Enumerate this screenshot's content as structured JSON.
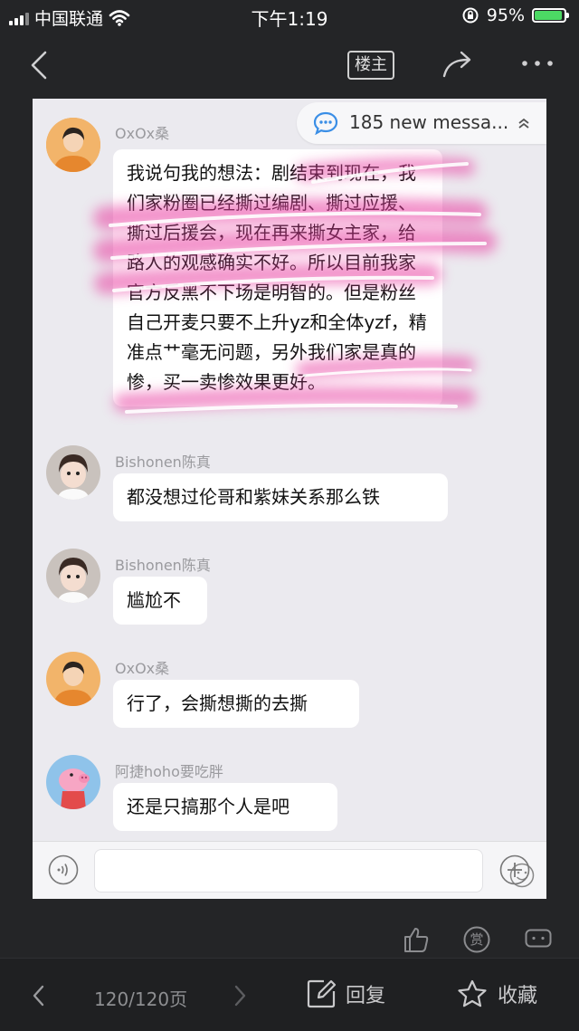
{
  "status_bar": {
    "carrier": "中国联通",
    "time": "下午1:19",
    "battery_percent": "95%",
    "battery_level": 0.95,
    "battery_color": "#4cd964"
  },
  "nav_bar": {
    "back_icon": "chevron-left-icon",
    "louzhu_label": "楼主",
    "share_icon": "share-arrow-icon",
    "more_icon": "more-dots-icon"
  },
  "chat": {
    "new_messages_banner": "185 new messa...",
    "messages": [
      {
        "sender": "OxOx桑",
        "text": "我说句我的想法：剧结束到现在，我们家粉圈已经撕过编剧、撕过应援、撕过后援会，现在再来撕女主家，给路人的观感确实不好。所以目前我家官方反黑不下场是明智的。但是粉丝自己开麦只要不上升yz和全体yzf，精准点艹毫无问题，另外我们家是真的惨，买一卖惨效果更好。"
      },
      {
        "sender": "Bishonen陈真",
        "text": "都没想过伦哥和紫妹关系那么铁"
      },
      {
        "sender": "Bishonen陈真",
        "text": "尴尬不"
      },
      {
        "sender": "OxOx桑",
        "text": "行了，会撕想撕的去撕"
      },
      {
        "sender": "阿捷hoho要吃胖",
        "text": "还是只搞那个人是吧"
      }
    ],
    "highlight_color": "#e83ea0"
  },
  "post_actions": {
    "like_icon": "thumbs-up-icon",
    "reward_label": "赏",
    "comment_icon": "comment-icon"
  },
  "bottom_bar": {
    "pages": "120/120页",
    "reply_label": "回复",
    "favorite_label": "收藏"
  }
}
